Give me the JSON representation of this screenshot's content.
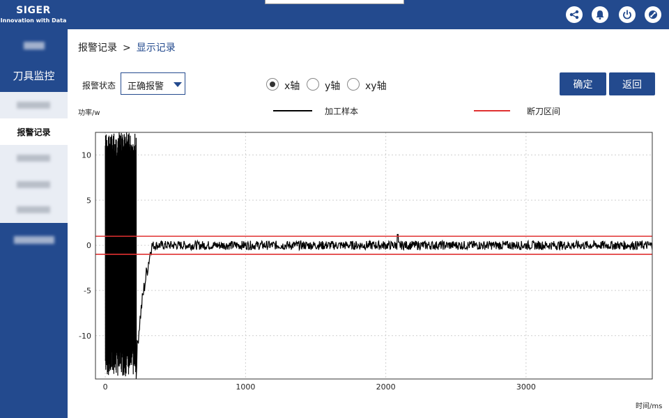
{
  "header": {
    "brand_name": "SIGER",
    "brand_tagline": "Innovation with Data",
    "icons": [
      "share-icon",
      "bell-icon",
      "power-icon",
      "link-icon"
    ],
    "color": "#234a8e"
  },
  "sidebar": {
    "section_title": "刀具监控",
    "active_item": "报警记录"
  },
  "breadcrumb": {
    "parent": "报警记录",
    "separator": ">",
    "current": "显示记录"
  },
  "filters": {
    "status_label": "报警状态",
    "status_value": "正确报警",
    "axes": [
      {
        "label": "x轴",
        "selected": true
      },
      {
        "label": "y轴",
        "selected": false
      },
      {
        "label": "xy轴",
        "selected": false
      }
    ],
    "confirm_label": "确定",
    "back_label": "返回"
  },
  "chart_data": {
    "type": "line",
    "ylabel": "功率/w",
    "xlabel": "时间/ms",
    "xlim": [
      -70,
      3900
    ],
    "ylim": [
      -14.8,
      12.5
    ],
    "x_ticks": [
      0,
      1000,
      2000,
      3000
    ],
    "y_ticks": [
      -10,
      -5,
      0,
      5,
      10
    ],
    "grid": true,
    "legend_position": "top",
    "series": [
      {
        "name": "加工样本",
        "color": "#000000",
        "segments": [
          {
            "x_range": [
              0,
              220
            ],
            "behavior": "oscillation",
            "amplitude_range": [
              -14.5,
              12.5
            ]
          },
          {
            "x_range": [
              220,
              330
            ],
            "behavior": "settling",
            "from": -14.5,
            "to": 0
          },
          {
            "x_range": [
              330,
              3900
            ],
            "behavior": "noise",
            "mean": 0,
            "amplitude": 0.5
          },
          {
            "x_range": [
              2080,
              2090
            ],
            "behavior": "spike",
            "peak": 1.2
          }
        ]
      },
      {
        "name": "断刀区间",
        "color": "#e03030",
        "thresholds": [
          1.0,
          -1.0
        ]
      }
    ]
  }
}
